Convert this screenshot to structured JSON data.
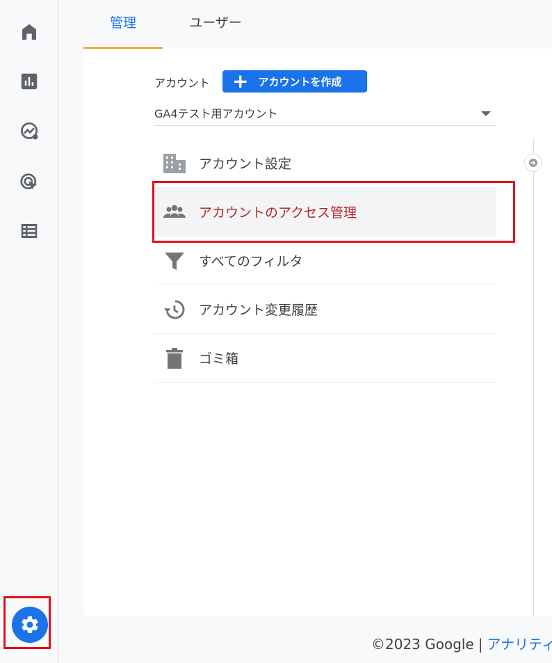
{
  "sidebar": {
    "items": [
      {
        "icon": "home-icon"
      },
      {
        "icon": "reports-icon"
      },
      {
        "icon": "explore-icon"
      },
      {
        "icon": "advertising-icon"
      },
      {
        "icon": "configure-icon"
      }
    ],
    "settings_icon": "gear-icon",
    "accent": "#1a73e8"
  },
  "tabs": {
    "admin": "管理",
    "user": "ユーザー"
  },
  "account": {
    "label": "アカウント",
    "create_button": "アカウントを作成",
    "selected": "GA4テスト用アカウント"
  },
  "menu": {
    "items": [
      {
        "label": "アカウント設定",
        "icon": "building-icon"
      },
      {
        "label": "アカウントのアクセス管理",
        "icon": "people-icon"
      },
      {
        "label": "すべてのフィルタ",
        "icon": "filter-icon"
      },
      {
        "label": "アカウント変更履歴",
        "icon": "history-icon"
      },
      {
        "label": "ゴミ箱",
        "icon": "trash-icon"
      }
    ],
    "active_color": "#b3282d",
    "highlight_color": "#e0101c"
  },
  "footer": {
    "copyright": "©2023 Google",
    "separator": "|",
    "link": "アナリティ"
  }
}
